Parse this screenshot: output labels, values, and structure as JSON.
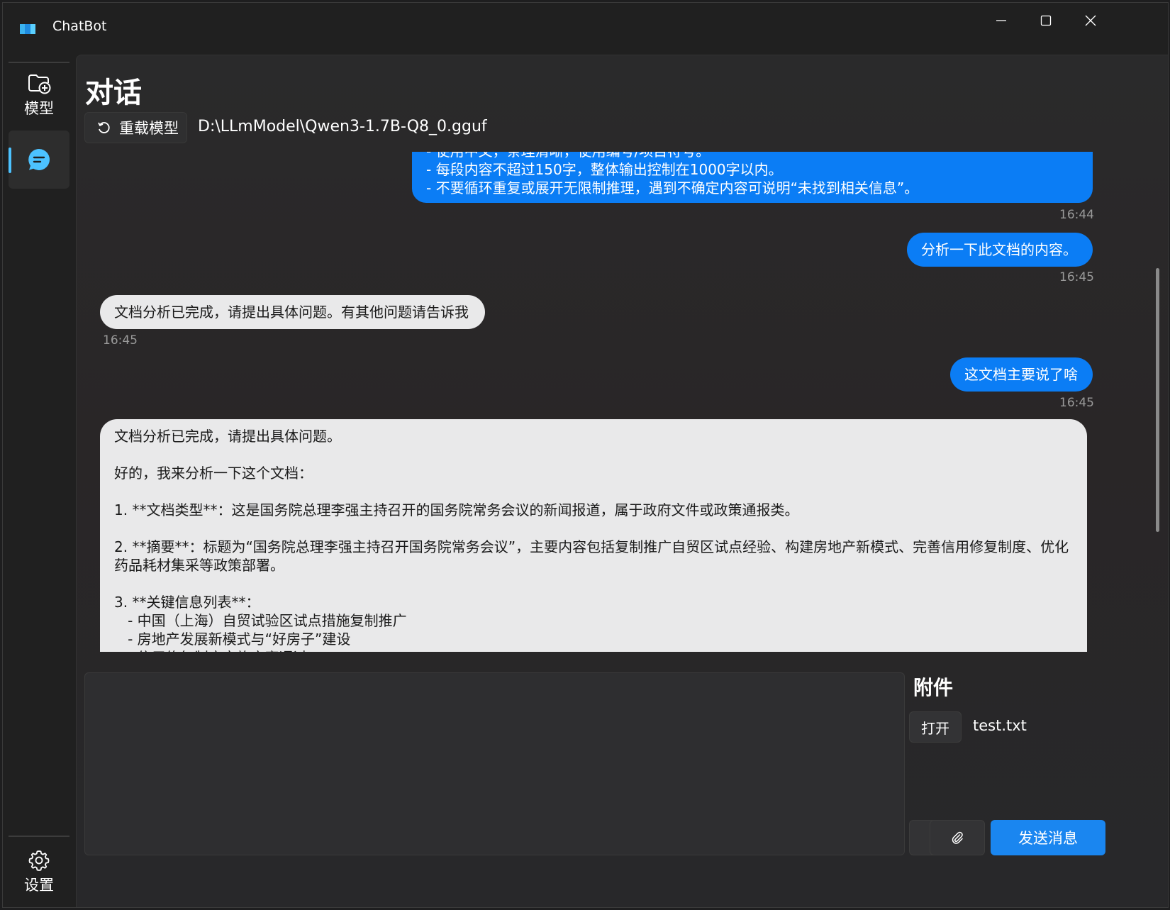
{
  "app": {
    "title": "ChatBot"
  },
  "titlebar_buttons": [
    "minimize",
    "maximize",
    "close"
  ],
  "sidebar": {
    "items": [
      {
        "label": "模型",
        "icon": "folder-add-icon"
      },
      {
        "label": "",
        "icon": "chat-icon",
        "active": true
      }
    ],
    "footer": {
      "label": "设置",
      "icon": "gear-icon"
    }
  },
  "page": {
    "title": "对话",
    "reload_label": "重载模型",
    "model_path": "D:\\LLmModel\\Qwen3-1.7B-Q8_0.gguf"
  },
  "messages": [
    {
      "role": "user",
      "text": "- 使用中文，条理清晰，使用编号/项目符号。\n- 每段内容不超过150字，整体输出控制在1000字以内。\n- 不要循环重复或展开无限制推理，遇到不确定内容可说明“未找到相关信息”。",
      "time": "16:44"
    },
    {
      "role": "user",
      "text": "分析一下此文档的内容。",
      "time": "16:45"
    },
    {
      "role": "bot",
      "text": "文档分析已完成，请提出具体问题。有其他问题请告诉我",
      "time": "16:45"
    },
    {
      "role": "user",
      "text": "这文档主要说了啥",
      "time": "16:45"
    },
    {
      "role": "bot",
      "text": "文档分析已完成，请提出具体问题。\n\n好的，我来分析一下这个文档：\n\n1. **文档类型**：这是国务院总理李强主持召开的国务院常务会议的新闻报道，属于政府文件或政策通报类。\n\n2. **摘要**：标题为“国务院总理李强主持召开国务院常务会议”，主要内容包括复制推广自贸区试点经验、构建房地产新模式、完善信用修复制度、优化药品耗材集采等政策部署。\n\n3. **关键信息列表**：\n   - 中国（上海）自贸试验区试点措施复制推广\n   - 房地产发展新模式与“好房子”建设\n   - 信用修复制度实施方案通过",
      "time": ""
    }
  ],
  "attachments": {
    "title": "附件",
    "open_label": "打开",
    "file_name": "test.txt"
  },
  "composer": {
    "placeholder": "",
    "send_label": "发送消息"
  },
  "colors": {
    "accent": "#0b7df5",
    "send": "#1a86f0",
    "indicator": "#4cc2ff"
  }
}
